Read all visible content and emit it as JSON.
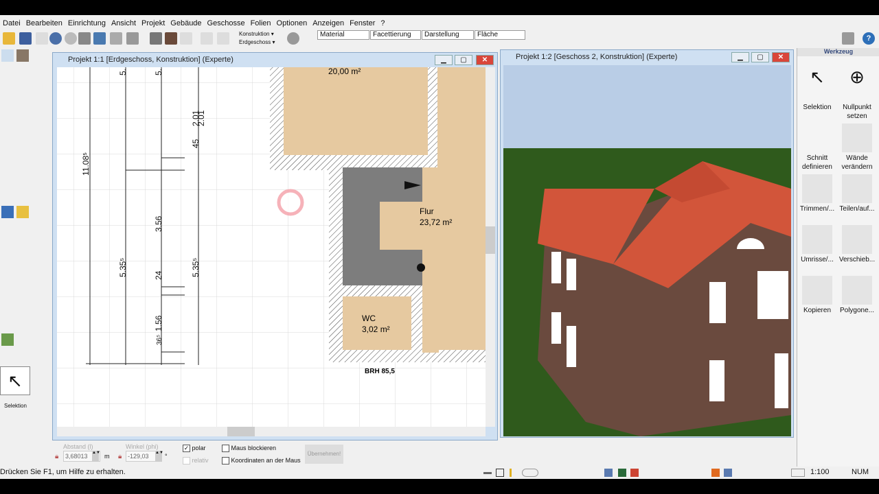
{
  "menu": [
    "Datei",
    "Bearbeiten",
    "Einrichtung",
    "Ansicht",
    "Projekt",
    "Gebäude",
    "Geschosse",
    "Folien",
    "Optionen",
    "Anzeigen",
    "Fenster",
    "?"
  ],
  "toolbar": {
    "layer_dropdown": "Konstruktion",
    "floor_dropdown": "Erdgeschoss",
    "segments": [
      "Material",
      "Facettierung",
      "Darstellung",
      "Fläche"
    ]
  },
  "left_toolbar": {
    "current_tool_label": "Selektion"
  },
  "window1": {
    "title": "Projekt 1:1 [Erdgeschoss, Konstruktion] (Experte)",
    "dimensions": [
      "11.08⁵",
      "5.",
      "5.",
      "2.01",
      "2.01",
      "45",
      "3.56",
      "5.35⁵",
      "5.35⁵",
      "24",
      "1.56",
      "36⁵"
    ],
    "rooms": [
      {
        "name": "",
        "area": "20,00 m²"
      },
      {
        "name": "Flur",
        "area": "23,72 m²"
      },
      {
        "name": "WC",
        "area": "3,02 m²"
      }
    ],
    "window_label": "BRH 85,5"
  },
  "window2": {
    "title": "Projekt 1:2 [Geschoss 2, Konstruktion] (Experte)",
    "colors": {
      "sky": "#b9cde6",
      "grass": "#2f5a1c",
      "roof": "#d2553a",
      "brick": "#6a4a3e"
    }
  },
  "panel": {
    "title": "Werkzeug",
    "tools": [
      "Selektion",
      "Nullpunkt setzen",
      "Schnitt definieren",
      "Wände verändern",
      "Trimmen/...",
      "Teilen/auf...",
      "Umrisse/...",
      "Verschieb...",
      "Kopieren",
      "Polygone..."
    ]
  },
  "input_bar": {
    "distance_label": "Abstand (l)",
    "distance_value": "3,68013",
    "distance_unit": "m",
    "angle_label": "Winkel (phi)",
    "angle_value": "-129,03",
    "angle_unit": "°",
    "polar": "polar",
    "polar_checked": true,
    "relativ": "relativ",
    "maus_blockieren": "Maus blockieren",
    "koordinaten": "Koordinaten an der Maus",
    "apply": "Übernehmen!"
  },
  "status": {
    "help": "Drücken Sie F1, um Hilfe zu erhalten.",
    "scale": "1:100",
    "num": "NUM"
  }
}
